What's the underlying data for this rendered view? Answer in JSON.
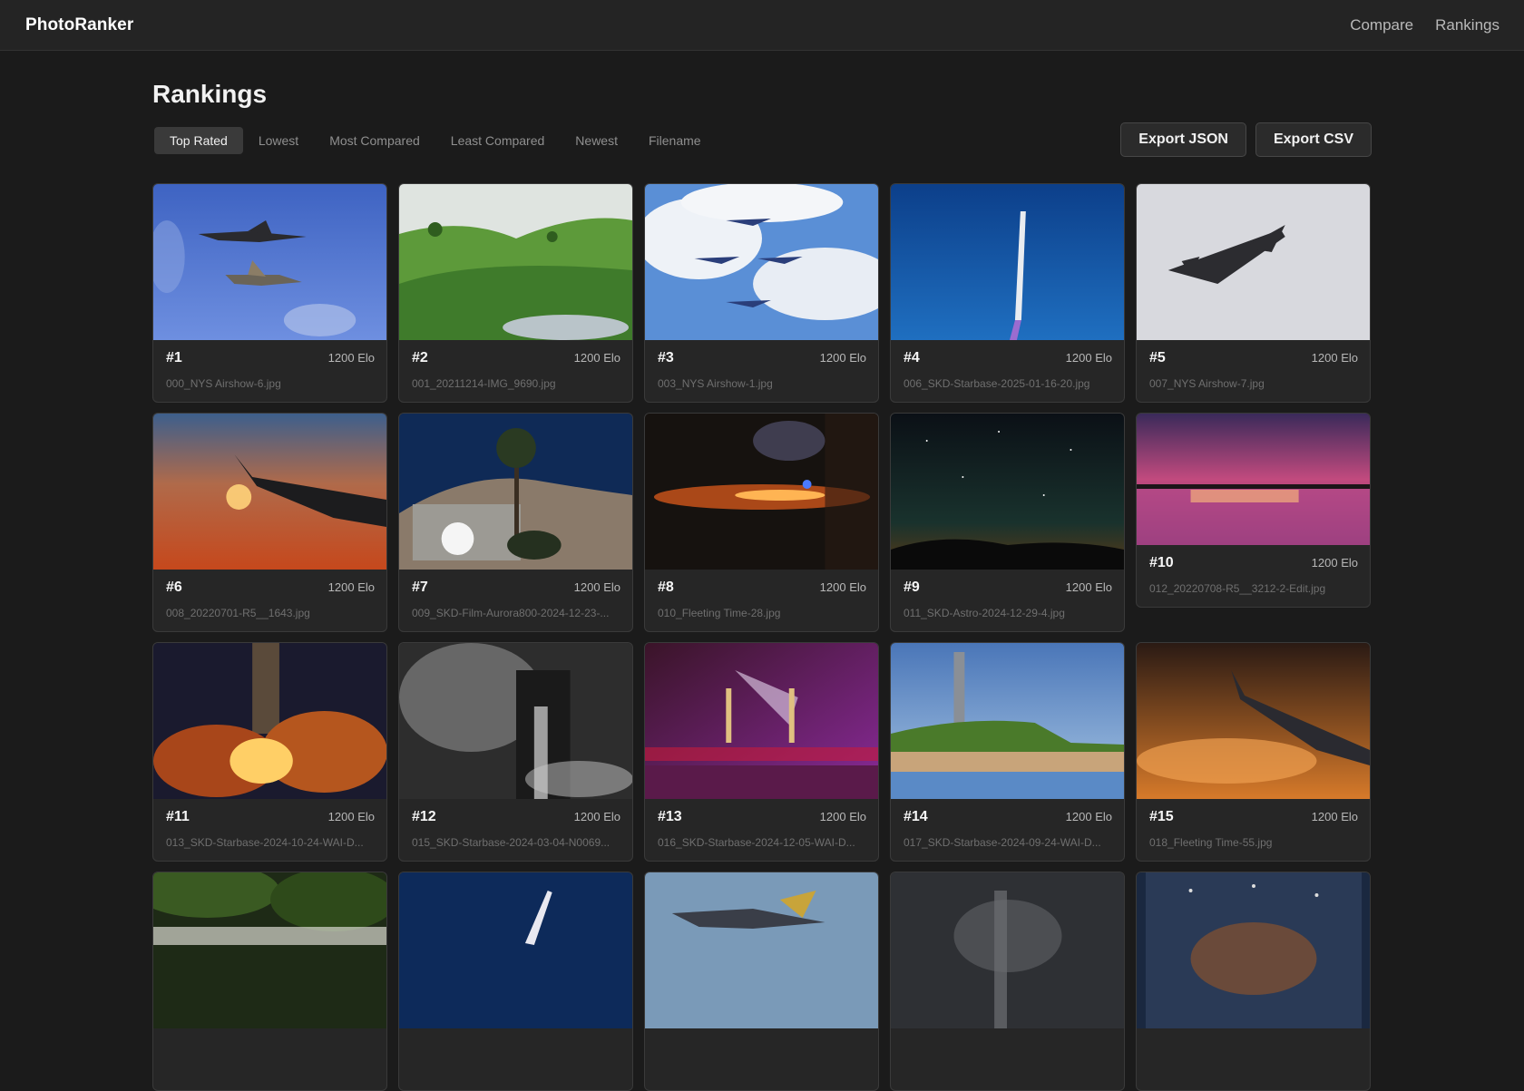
{
  "app": {
    "brand": "PhotoRanker"
  },
  "nav": {
    "compare": "Compare",
    "rankings": "Rankings"
  },
  "page": {
    "title": "Rankings"
  },
  "sort_tabs": [
    {
      "label": "Top Rated",
      "active": true
    },
    {
      "label": "Lowest",
      "active": false
    },
    {
      "label": "Most Compared",
      "active": false
    },
    {
      "label": "Least Compared",
      "active": false
    },
    {
      "label": "Newest",
      "active": false
    },
    {
      "label": "Filename",
      "active": false
    }
  ],
  "export": {
    "json_label": "Export JSON",
    "csv_label": "Export CSV"
  },
  "photos": [
    {
      "rank": "#1",
      "elo": "1200 Elo",
      "filename": "000_NYS Airshow-6.jpg"
    },
    {
      "rank": "#2",
      "elo": "1200 Elo",
      "filename": "001_20211214-IMG_9690.jpg"
    },
    {
      "rank": "#3",
      "elo": "1200 Elo",
      "filename": "003_NYS Airshow-1.jpg"
    },
    {
      "rank": "#4",
      "elo": "1200 Elo",
      "filename": "006_SKD-Starbase-2025-01-16-20.jpg"
    },
    {
      "rank": "#5",
      "elo": "1200 Elo",
      "filename": "007_NYS Airshow-7.jpg"
    },
    {
      "rank": "#6",
      "elo": "1200 Elo",
      "filename": "008_20220701-R5__1643.jpg"
    },
    {
      "rank": "#7",
      "elo": "1200 Elo",
      "filename": "009_SKD-Film-Aurora800-2024-12-23-..."
    },
    {
      "rank": "#8",
      "elo": "1200 Elo",
      "filename": "010_Fleeting Time-28.jpg"
    },
    {
      "rank": "#9",
      "elo": "1200 Elo",
      "filename": "011_SKD-Astro-2024-12-29-4.jpg"
    },
    {
      "rank": "#10",
      "elo": "1200 Elo",
      "filename": "012_20220708-R5__3212-2-Edit.jpg"
    },
    {
      "rank": "#11",
      "elo": "1200 Elo",
      "filename": "013_SKD-Starbase-2024-10-24-WAI-D..."
    },
    {
      "rank": "#12",
      "elo": "1200 Elo",
      "filename": "015_SKD-Starbase-2024-03-04-N0069..."
    },
    {
      "rank": "#13",
      "elo": "1200 Elo",
      "filename": "016_SKD-Starbase-2024-12-05-WAI-D..."
    },
    {
      "rank": "#14",
      "elo": "1200 Elo",
      "filename": "017_SKD-Starbase-2024-09-24-WAI-D..."
    },
    {
      "rank": "#15",
      "elo": "1200 Elo",
      "filename": "018_Fleeting Time-55.jpg"
    },
    {
      "rank": "",
      "elo": "",
      "filename": ""
    },
    {
      "rank": "",
      "elo": "",
      "filename": ""
    },
    {
      "rank": "",
      "elo": "",
      "filename": ""
    },
    {
      "rank": "",
      "elo": "",
      "filename": ""
    },
    {
      "rank": "",
      "elo": "",
      "filename": ""
    }
  ]
}
